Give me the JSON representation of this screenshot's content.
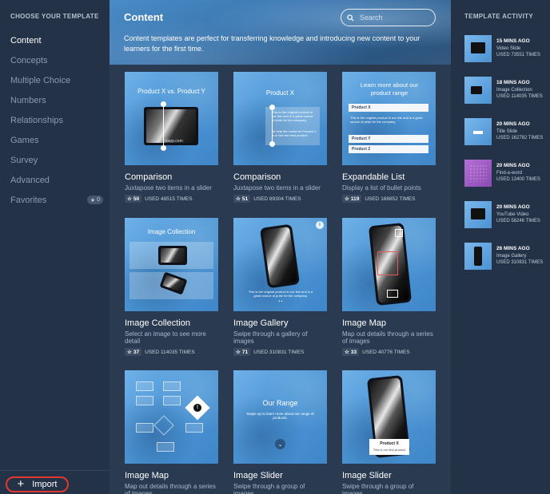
{
  "sidebar": {
    "heading": "CHOOSE YOUR TEMPLATE",
    "items": [
      {
        "label": "Content"
      },
      {
        "label": "Concepts"
      },
      {
        "label": "Multiple Choice"
      },
      {
        "label": "Numbers"
      },
      {
        "label": "Relationships"
      },
      {
        "label": "Games"
      },
      {
        "label": "Survey"
      },
      {
        "label": "Advanced"
      },
      {
        "label": "Favorites",
        "badge": "0"
      }
    ],
    "import_label": "Import"
  },
  "main": {
    "title": "Content",
    "description": "Content templates are perfect for transferring knowledge and introducing new content to your learners for the first time.",
    "search_placeholder": "Search",
    "cards": [
      {
        "title": "Comparison",
        "desc": "Juxtapose two items in a slider",
        "stars": "50",
        "used": "USED 48515 TIMES",
        "thumb_title": "Product X vs. Product Y",
        "thumb_brand": "edapp.com"
      },
      {
        "title": "Comparison",
        "desc": "Juxtapose two items in a slider",
        "stars": "51",
        "used": "USED 89304 TIMES",
        "thumb_title": "Product X",
        "thumb_text": "This is the original product in our line and is a great source of pride for the company.",
        "thumb_text2": "To help the customer Product X is in fact the best product."
      },
      {
        "title": "Expandable List",
        "desc": "Display a list of bullet points",
        "stars": "119",
        "used": "USED 168852 TIMES",
        "thumb_title": "Learn more about our product range",
        "rows": [
          "Product X",
          "Product Y",
          "Product Z"
        ],
        "thumb_text": "This is the original product in our line and is a great source of pride for the company."
      },
      {
        "title": "Image Collection",
        "desc": "Select an image to see more detail",
        "stars": "37",
        "used": "USED 114035 TIMES",
        "thumb_title": "Image Collection"
      },
      {
        "title": "Image Gallery",
        "desc": "Swipe through a gallery of images",
        "stars": "71",
        "used": "USED 310831 TIMES",
        "thumb_text": "This is the original product in our line and is a great source of pride for the company."
      },
      {
        "title": "Image Map",
        "desc": "Map out details through a series of images",
        "stars": "33",
        "used": "USED 40776 TIMES"
      },
      {
        "title": "Image Map",
        "desc": "Map out details through a series of images"
      },
      {
        "title": "Image Slider",
        "desc": "Swipe through a group of images",
        "thumb_title": "Our Range",
        "thumb_text": "Swipe up to learn more about our range of products."
      },
      {
        "title": "Image Slider",
        "desc": "Swipe through a group of images",
        "thumb_caption_title": "Product X",
        "thumb_caption_text": "This is our first product"
      }
    ]
  },
  "activity": {
    "heading": "TEMPLATE ACTIVITY",
    "items": [
      {
        "time": "15 MINS AGO",
        "type": "Video Slide",
        "used": "USED 73551 TIMES"
      },
      {
        "time": "18 MINS AGO",
        "type": "Image Collection",
        "used": "USED 114035 TIMES"
      },
      {
        "time": "20 MINS AGO",
        "type": "Title Slide",
        "used": "USED 162782 TIMES"
      },
      {
        "time": "20 MINS AGO",
        "type": "Find-a-word",
        "used": "USED 13400 TIMES"
      },
      {
        "time": "20 MINS AGO",
        "type": "YouTube Video",
        "used": "USED 58246 TIMES"
      },
      {
        "time": "26 MINS AGO",
        "type": "Image Gallery",
        "used": "USED 310831 TIMES"
      }
    ]
  }
}
